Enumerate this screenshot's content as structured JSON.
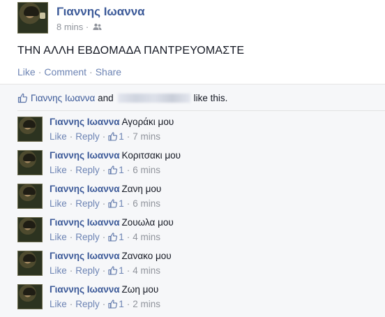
{
  "post": {
    "author": "Γιαννης Ιωαννα",
    "time": "8 mins",
    "meta_separator": "·",
    "audience_icon": "friends-icon",
    "text": "ΤΗΝ ΑΛΛΗ ΕΒΔΟΜΑΔΑ ΠΑΝΤΡΕΥΟΜΑΣΤΕ",
    "actions": {
      "like": "Like",
      "comment": "Comment",
      "share": "Share",
      "separator": "·"
    }
  },
  "likes": {
    "name": "Γιαννης Ιωαννα",
    "and": "and",
    "suffix": "like this.",
    "icon": "thumbs-up-icon"
  },
  "comments": [
    {
      "author": "Γιαννης Ιωαννα",
      "text": "Αγοράκι μου",
      "like": "Like",
      "reply": "Reply",
      "likes": "1",
      "time": "7 mins"
    },
    {
      "author": "Γιαννης Ιωαννα",
      "text": "Κοριτσακι μου",
      "like": "Like",
      "reply": "Reply",
      "likes": "1",
      "time": "6 mins"
    },
    {
      "author": "Γιαννης Ιωαννα",
      "text": "Ζανη μου",
      "like": "Like",
      "reply": "Reply",
      "likes": "1",
      "time": "6 mins"
    },
    {
      "author": "Γιαννης Ιωαννα",
      "text": "Ζουωλα μου",
      "like": "Like",
      "reply": "Reply",
      "likes": "1",
      "time": "4 mins"
    },
    {
      "author": "Γιαννης Ιωαννα",
      "text": "Ζανακο μου",
      "like": "Like",
      "reply": "Reply",
      "likes": "1",
      "time": "4 mins"
    },
    {
      "author": "Γιαννης Ιωαννα",
      "text": "Ζωη μου",
      "like": "Like",
      "reply": "Reply",
      "likes": "1",
      "time": "2 mins"
    }
  ],
  "comment_separator": "·",
  "colors": {
    "link": "#3b5998",
    "action": "#6d84b4",
    "meta": "#90949c",
    "ufi_bg": "#f6f7f9"
  }
}
